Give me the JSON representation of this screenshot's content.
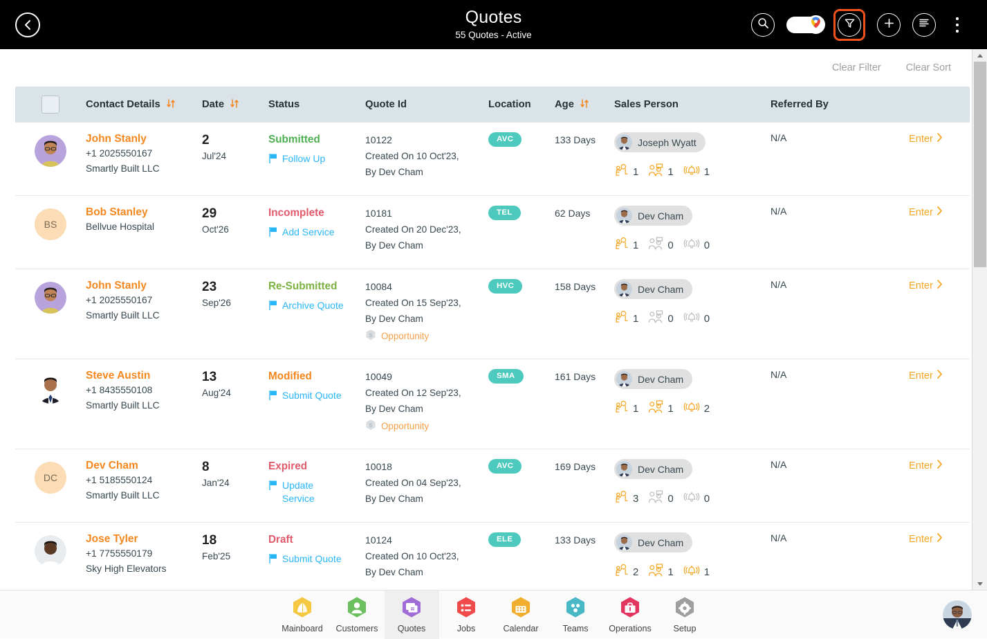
{
  "header": {
    "back_icon": "chevron-left-icon",
    "title": "Quotes",
    "subtitle": "55 Quotes - Active",
    "actions": {
      "search_icon": "search-icon",
      "map_toggle_icon": "map-pin-toggle",
      "filter_icon": "filter-icon",
      "add_icon": "plus-icon",
      "list_icon": "list-lines-icon",
      "more_icon": "kebab-menu-icon"
    },
    "filter_highlight_color": "#f4511e"
  },
  "toolbar": {
    "clear_filter_label": "Clear Filter",
    "clear_sort_label": "Clear Sort"
  },
  "table": {
    "columns": [
      {
        "label": "",
        "sortable": false
      },
      {
        "label": "Contact Details",
        "sortable": true
      },
      {
        "label": "Date",
        "sortable": true
      },
      {
        "label": "Status",
        "sortable": false
      },
      {
        "label": "Quote Id",
        "sortable": false
      },
      {
        "label": "Location",
        "sortable": false
      },
      {
        "label": "Age",
        "sortable": true
      },
      {
        "label": "Sales Person",
        "sortable": false
      },
      {
        "label": "Referred By",
        "sortable": false
      }
    ],
    "enter_label": "Enter",
    "rows": [
      {
        "avatar_type": "photo-male-glasses",
        "avatar_initials": "",
        "name": "John Stanly",
        "phone": "+1 2025550167",
        "company": "Smartly Built LLC",
        "date_day": "2",
        "date_month": "Jul'24",
        "status": "Submitted",
        "status_color": "#4caf50",
        "action": "Follow Up",
        "quote_id": "10122",
        "created_on": "Created On 10 Oct'23,",
        "created_by": "By Dev Cham",
        "opportunity": "",
        "location": "AVC",
        "age": "133 Days",
        "sales_person": "Joseph Wyatt",
        "counts": {
          "inspection": "1",
          "meeting": "1",
          "reminder": "1"
        },
        "referred_by": "N/A"
      },
      {
        "avatar_type": "initials",
        "avatar_initials": "BS",
        "name": "Bob Stanley",
        "phone": "",
        "company": "Bellvue Hospital",
        "date_day": "29",
        "date_month": "Oct'26",
        "status": "Incomplete",
        "status_color": "#e05a6b",
        "action": "Add Service",
        "quote_id": "10181",
        "created_on": "Created On 20 Dec'23,",
        "created_by": "By Dev Cham",
        "opportunity": "",
        "location": "TEL",
        "age": "62 Days",
        "sales_person": "Dev Cham",
        "counts": {
          "inspection": "1",
          "meeting": "0",
          "reminder": "0"
        },
        "referred_by": "N/A"
      },
      {
        "avatar_type": "photo-male-glasses",
        "avatar_initials": "",
        "name": "John Stanly",
        "phone": "+1 2025550167",
        "company": "Smartly Built LLC",
        "date_day": "23",
        "date_month": "Sep'26",
        "status": "Re-Submitted",
        "status_color": "#7cb342",
        "action": "Archive Quote",
        "quote_id": "10084",
        "created_on": "Created On 15 Sep'23,",
        "created_by": "By Dev Cham",
        "opportunity": "Opportunity",
        "location": "HVC",
        "age": "158 Days",
        "sales_person": "Dev Cham",
        "counts": {
          "inspection": "1",
          "meeting": "0",
          "reminder": "0"
        },
        "referred_by": "N/A"
      },
      {
        "avatar_type": "photo-male-suit",
        "avatar_initials": "",
        "name": "Steve Austin",
        "phone": "+1 8435550108",
        "company": "Smartly Built LLC",
        "date_day": "13",
        "date_month": "Aug'24",
        "status": "Modified",
        "status_color": "#f5871f",
        "action": "Submit Quote",
        "quote_id": "10049",
        "created_on": "Created On 12 Sep'23,",
        "created_by": "By Dev Cham",
        "opportunity": "Opportunity",
        "location": "SMA",
        "age": "161 Days",
        "sales_person": "Dev Cham",
        "counts": {
          "inspection": "1",
          "meeting": "1",
          "reminder": "2"
        },
        "referred_by": "N/A"
      },
      {
        "avatar_type": "initials",
        "avatar_initials": "DC",
        "name": "Dev Cham",
        "phone": "+1 5185550124",
        "company": "Smartly Built LLC",
        "date_day": "8",
        "date_month": "Jan'24",
        "status": "Expired",
        "status_color": "#e05a6b",
        "action": "Update Service",
        "quote_id": "10018",
        "created_on": "Created On 04 Sep'23,",
        "created_by": "By Dev Cham",
        "opportunity": "",
        "location": "AVC",
        "age": "169 Days",
        "sales_person": "Dev Cham",
        "counts": {
          "inspection": "3",
          "meeting": "0",
          "reminder": "0"
        },
        "referred_by": "N/A"
      },
      {
        "avatar_type": "photo-male-dark",
        "avatar_initials": "",
        "name": "Jose Tyler",
        "phone": "+1 7755550179",
        "company": "Sky High Elevators",
        "date_day": "18",
        "date_month": "Feb'25",
        "status": "Draft",
        "status_color": "#e05a6b",
        "action": "Submit Quote",
        "quote_id": "10124",
        "created_on": "Created On 10 Oct'23,",
        "created_by": "By Dev Cham",
        "opportunity": "",
        "location": "ELE",
        "age": "133 Days",
        "sales_person": "Dev Cham",
        "counts": {
          "inspection": "2",
          "meeting": "1",
          "reminder": "1"
        },
        "referred_by": "N/A"
      }
    ]
  },
  "bottom_nav": {
    "items": [
      {
        "label": "Mainboard",
        "icon": "mainboard-icon",
        "color": "#f5c842",
        "active": false
      },
      {
        "label": "Customers",
        "icon": "customers-icon",
        "color": "#6cbf5e",
        "active": false
      },
      {
        "label": "Quotes",
        "icon": "quotes-icon",
        "color": "#a06cd5",
        "active": true
      },
      {
        "label": "Jobs",
        "icon": "jobs-icon",
        "color": "#ef4b4b",
        "active": false
      },
      {
        "label": "Calendar",
        "icon": "calendar-icon",
        "color": "#f0ad2e",
        "active": false
      },
      {
        "label": "Teams",
        "icon": "teams-icon",
        "color": "#4ab8c4",
        "active": false
      },
      {
        "label": "Operations",
        "icon": "operations-icon",
        "color": "#e2355f",
        "active": false
      },
      {
        "label": "Setup",
        "icon": "setup-icon",
        "color": "#9e9e9e",
        "active": false
      }
    ],
    "profile_icon": "user-avatar"
  },
  "scrollbar": {
    "up_icon": "caret-up-icon",
    "down_icon": "caret-down-icon"
  }
}
